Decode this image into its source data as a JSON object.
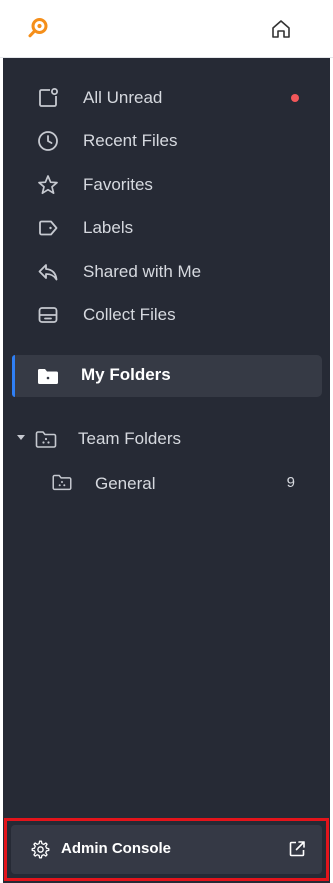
{
  "colors": {
    "sidebar_bg": "#262a35",
    "selected_bg": "#363a45",
    "accent": "#2f7ff4",
    "unread_dot": "#f2575a",
    "logo": "#f58f1a",
    "highlight_border": "#e3141b"
  },
  "header": {
    "logo_icon": "search-logo-icon",
    "home_icon": "home-icon"
  },
  "nav": {
    "items": [
      {
        "label": "All Unread",
        "icon": "unread-icon"
      },
      {
        "label": "Recent Files",
        "icon": "clock-icon"
      },
      {
        "label": "Favorites",
        "icon": "star-icon"
      },
      {
        "label": "Labels",
        "icon": "tag-icon"
      },
      {
        "label": "Shared with Me",
        "icon": "shared-icon"
      },
      {
        "label": "Collect Files",
        "icon": "inbox-icon"
      }
    ],
    "my_folders": {
      "label": "My Folders",
      "icon": "folder-icon"
    },
    "team_folders": {
      "label": "Team Folders",
      "icon": "team-folder-icon"
    },
    "general": {
      "label": "General",
      "count": "9",
      "icon": "team-folder-icon"
    }
  },
  "footer": {
    "admin_label": "Admin Console",
    "gear_icon": "gear-icon",
    "external_icon": "external-link-icon"
  }
}
